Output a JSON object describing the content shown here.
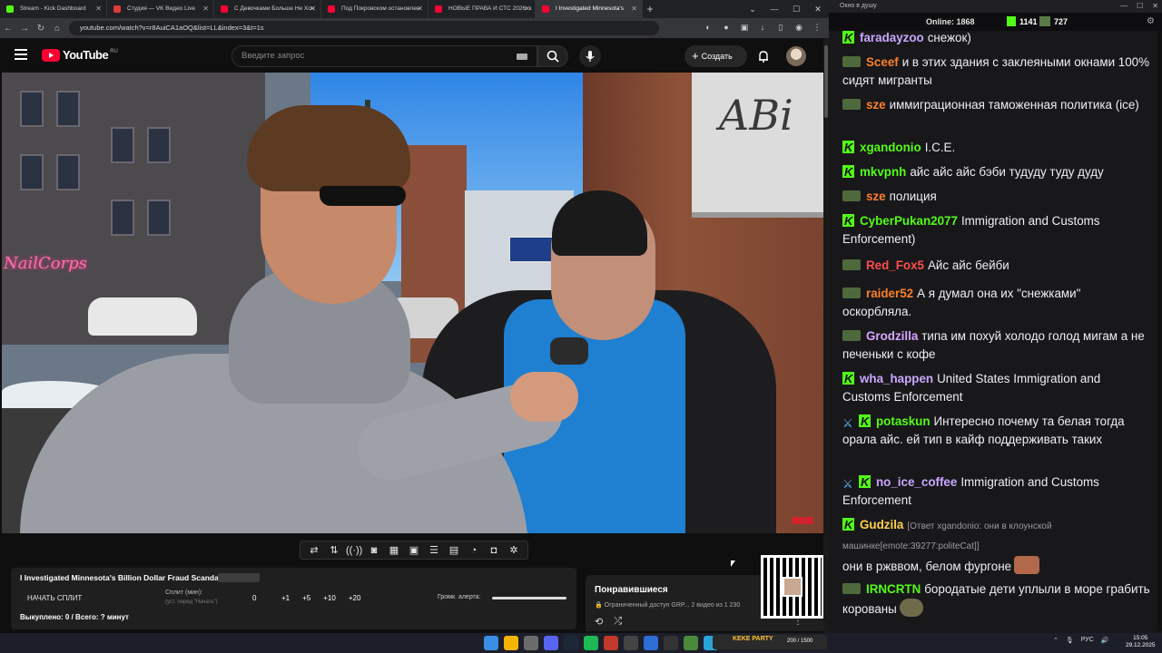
{
  "browser": {
    "tabs": [
      {
        "label": "Stream - Kick Dashboard",
        "color": "#53fc18"
      },
      {
        "label": "Студия — VK Видео Live",
        "color": "#e23b3b"
      },
      {
        "label": "С Девочками Больше Не Хоч",
        "color": "#ff0033"
      },
      {
        "label": "Под Покровском остановлен",
        "color": "#ff0033"
      },
      {
        "label": "НОВЫЕ ПРАВА И СТС 2026: к",
        "color": "#ff0033"
      },
      {
        "label": "I Investigated Minnesota's",
        "color": "#ff0033"
      }
    ],
    "url": "youtube.com/watch?v=r8AuiCA1aOQ&list=LL&index=3&t=1s"
  },
  "youtube": {
    "logo": "YouTube",
    "region": "RU",
    "search_placeholder": "Введите запрос",
    "create_label": "Создать"
  },
  "video": {
    "storefront_neon": "NailCorps",
    "awning_text": "ABi"
  },
  "controls": {
    "icons": [
      "repeat-icon",
      "sort-icon",
      "broadcast-icon",
      "eye-screen-icon",
      "calendar-icon",
      "pip-icon",
      "list-icon",
      "clip-icon",
      "speed-icon",
      "camera-icon",
      "settings-icon"
    ]
  },
  "info_panel": {
    "title": "I Investigated Minnesota's Billion Dollar Fraud Scandal",
    "badge": "",
    "split_button": "НАЧАТЬ СПЛИТ",
    "split_min_label": "Сплит (мин):",
    "split_min_hint": "(уст. перед \"Начать\")",
    "split_value": "0",
    "add_buttons": [
      "+1",
      "+5",
      "+10",
      "+20"
    ],
    "alert_volume_label": "Громк. алерта:",
    "bought": "Выкуплено: 0 / Всего: ? минут"
  },
  "liked": {
    "title": "Понравившиеся",
    "subtitle": "Ограниченный доступ GRP...",
    "count": "2 видео из 1 230"
  },
  "chat": {
    "window_title": "Окно в душу",
    "online_label": "Online:",
    "online_count": "1868",
    "kick_count": "1141",
    "twitch_count": "727",
    "messages": [
      {
        "badges": [
          "kick"
        ],
        "user": "faradayzoo",
        "color": "#c9a7ff",
        "text": "снежок)"
      },
      {
        "badges": [
          "twitch"
        ],
        "user": "Sceef",
        "color": "#ff7f2a",
        "text": "и в этих здания с заклеяными окнами 100% сидят мигранты"
      },
      {
        "badges": [
          "twitch"
        ],
        "user": "sze",
        "color": "#ff7f2a",
        "text": "иммиграционная таможенная политика (ice)"
      },
      {
        "badges": [
          "kick"
        ],
        "user": "xgandonio",
        "color": "#53fc18",
        "text": "I.C.E."
      },
      {
        "badges": [
          "kick"
        ],
        "user": "mkvpnh",
        "color": "#53fc18",
        "text": "айс айс айс бэби тудуду туду дуду"
      },
      {
        "badges": [
          "twitch"
        ],
        "user": "sze",
        "color": "#ff7f2a",
        "text": "полиция"
      },
      {
        "badges": [
          "kick"
        ],
        "user": "CyberPukan2077",
        "color": "#53fc18",
        "text": "Immigration and Customs Enforcement)"
      },
      {
        "badges": [
          "twitch"
        ],
        "user": "Red_Fox5",
        "color": "#ff4d4d",
        "text": "Айс айс бейби",
        "emote": "hand"
      },
      {
        "badges": [
          "twitch"
        ],
        "user": "raider52",
        "color": "#ff7f2a",
        "text": "А я думал она их \"снежками\" оскорбляла."
      },
      {
        "badges": [
          "twitch"
        ],
        "user": "Grodzilla",
        "color": "#d9a4ff",
        "text": "типа им похуй холодо голод мигам а не печеньки с кофе"
      },
      {
        "badges": [
          "kick"
        ],
        "user": "wha_happen",
        "color": "#c9a7ff",
        "text": "United States Immigration and Customs Enforcement"
      },
      {
        "badges": [
          "sword",
          "kick"
        ],
        "user": "potaskun",
        "color": "#53fc18",
        "text": "Интересно почему та белая тогда орала айс. ей тип в кайф поддерживать таких"
      },
      {
        "badges": [
          "sword",
          "kick"
        ],
        "user": "no_ice_coffee",
        "color": "#c9a7ff",
        "text": "Immigration and Customs Enforcement"
      },
      {
        "badges": [
          "kick"
        ],
        "user": "Gudzila",
        "color": "#ffd24d",
        "reply": "[Ответ xgandonio: они в клоунской машинке[emote:39277:politeCat]]",
        "text": "они в ржввом, белом фургоне",
        "emote": "face"
      },
      {
        "badges": [
          "twitch"
        ],
        "user": "IRNCRTN",
        "color": "#53fc18",
        "text": "бородатые дети уплыли в море грабить корованы",
        "emote": "orc"
      }
    ]
  },
  "taskbar": {
    "kekw_label": "KEKE PARTY",
    "kekw_count": "200 / 1500",
    "lang": "РУС",
    "time": "15:05",
    "date": "29.12.2025"
  }
}
